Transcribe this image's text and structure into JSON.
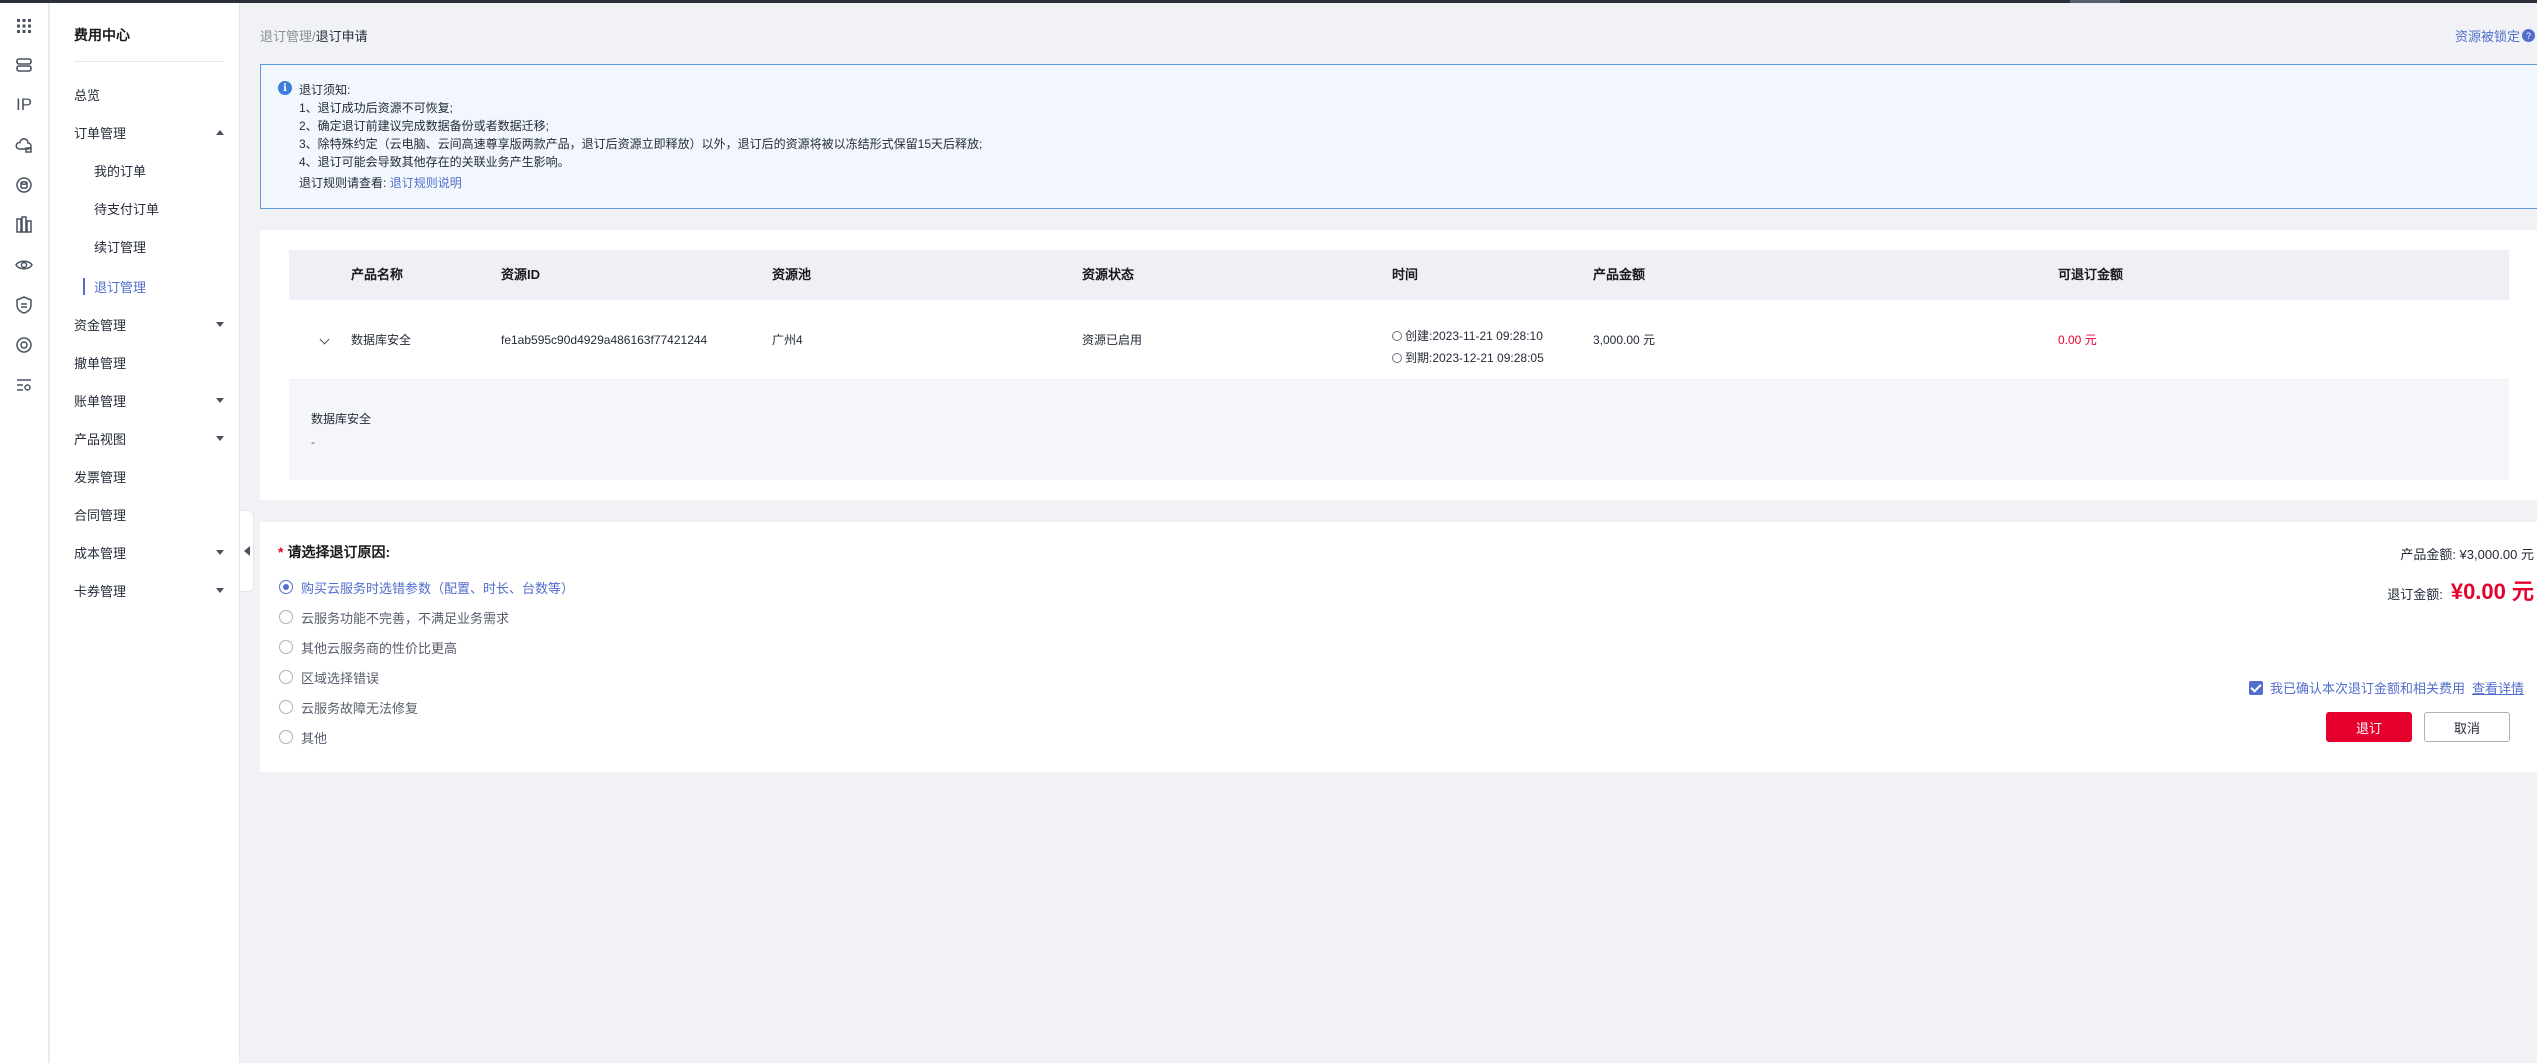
{
  "sidebar": {
    "title": "费用中心",
    "items": [
      {
        "label": "总览"
      },
      {
        "label": "订单管理"
      },
      {
        "label": "我的订单"
      },
      {
        "label": "待支付订单"
      },
      {
        "label": "续订管理"
      },
      {
        "label": "退订管理"
      },
      {
        "label": "资金管理"
      },
      {
        "label": "撤单管理"
      },
      {
        "label": "账单管理"
      },
      {
        "label": "产品视图"
      },
      {
        "label": "发票管理"
      },
      {
        "label": "合同管理"
      },
      {
        "label": "成本管理"
      },
      {
        "label": "卡券管理"
      }
    ]
  },
  "rail": {
    "ip_label": "IP"
  },
  "breadcrumb": {
    "parent": "退订管理",
    "sep": "/",
    "current": "退订申请"
  },
  "top_link": {
    "label": "资源被锁定",
    "icon": "?"
  },
  "notice": {
    "title": "退订须知:",
    "lines": [
      "1、退订成功后资源不可恢复;",
      "2、确定退订前建议完成数据备份或者数据迁移;",
      "3、除特殊约定（云电脑、云间高速尊享版两款产品，退订后资源立即释放）以外，退订后的资源将被以冻结形式保留15天后释放;",
      "4、退订可能会导致其他存在的关联业务产生影响。"
    ],
    "rules_prefix": "退订规则请查看:",
    "rules_link": "退订规则说明"
  },
  "table": {
    "headers": [
      "产品名称",
      "资源ID",
      "资源池",
      "资源状态",
      "时间",
      "产品金额",
      "可退订金额"
    ],
    "row": {
      "product_name": "数据库安全",
      "resource_id": "fe1ab595c90d4929a486163f77421244",
      "pool": "广州4",
      "status": "资源已启用",
      "created": "创建:2023-11-21 09:28:10",
      "expires": "到期:2023-12-21 09:28:05",
      "amount": "3,000.00 元",
      "refundable": "0.00 元"
    },
    "expanded": {
      "name": "数据库安全",
      "value": "-"
    }
  },
  "reason": {
    "title": "请选择退订原因:",
    "required_mark": "*",
    "options": [
      "购买云服务时选错参数（配置、时长、台数等）",
      "云服务功能不完善，不满足业务需求",
      "其他云服务商的性价比更高",
      "区域选择错误",
      "云服务故障无法修复",
      "其他"
    ],
    "selected_index": 0
  },
  "summary": {
    "product_amount": "产品金额:  ¥3,000.00 元",
    "refund_label": "退订金额:",
    "refund_amount": "¥0.00 元",
    "confirm_text": "我已确认本次退订金额和相关费用",
    "detail_link": "查看详情"
  },
  "buttons": {
    "submit": "退订",
    "cancel": "取消"
  },
  "colors": {
    "accent": "#526ecc",
    "danger": "#e6002d",
    "notice_bg": "#f1f7fd",
    "notice_border": "#5e9bd8"
  }
}
